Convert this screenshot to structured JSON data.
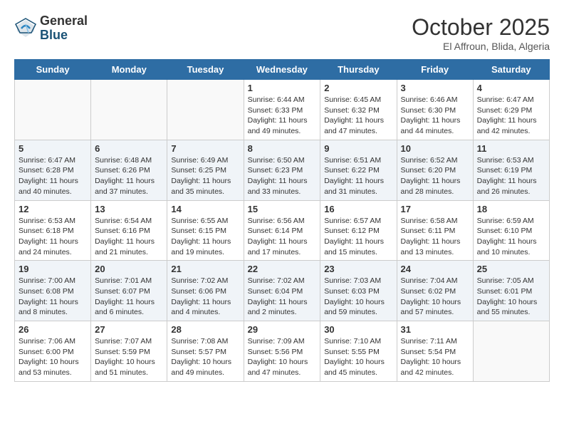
{
  "header": {
    "logo_general": "General",
    "logo_blue": "Blue",
    "month_title": "October 2025",
    "location": "El Affroun, Blida, Algeria"
  },
  "weekdays": [
    "Sunday",
    "Monday",
    "Tuesday",
    "Wednesday",
    "Thursday",
    "Friday",
    "Saturday"
  ],
  "weeks": [
    [
      {
        "day": "",
        "info": ""
      },
      {
        "day": "",
        "info": ""
      },
      {
        "day": "",
        "info": ""
      },
      {
        "day": "1",
        "info": "Sunrise: 6:44 AM\nSunset: 6:33 PM\nDaylight: 11 hours and 49 minutes."
      },
      {
        "day": "2",
        "info": "Sunrise: 6:45 AM\nSunset: 6:32 PM\nDaylight: 11 hours and 47 minutes."
      },
      {
        "day": "3",
        "info": "Sunrise: 6:46 AM\nSunset: 6:30 PM\nDaylight: 11 hours and 44 minutes."
      },
      {
        "day": "4",
        "info": "Sunrise: 6:47 AM\nSunset: 6:29 PM\nDaylight: 11 hours and 42 minutes."
      }
    ],
    [
      {
        "day": "5",
        "info": "Sunrise: 6:47 AM\nSunset: 6:28 PM\nDaylight: 11 hours and 40 minutes."
      },
      {
        "day": "6",
        "info": "Sunrise: 6:48 AM\nSunset: 6:26 PM\nDaylight: 11 hours and 37 minutes."
      },
      {
        "day": "7",
        "info": "Sunrise: 6:49 AM\nSunset: 6:25 PM\nDaylight: 11 hours and 35 minutes."
      },
      {
        "day": "8",
        "info": "Sunrise: 6:50 AM\nSunset: 6:23 PM\nDaylight: 11 hours and 33 minutes."
      },
      {
        "day": "9",
        "info": "Sunrise: 6:51 AM\nSunset: 6:22 PM\nDaylight: 11 hours and 31 minutes."
      },
      {
        "day": "10",
        "info": "Sunrise: 6:52 AM\nSunset: 6:20 PM\nDaylight: 11 hours and 28 minutes."
      },
      {
        "day": "11",
        "info": "Sunrise: 6:53 AM\nSunset: 6:19 PM\nDaylight: 11 hours and 26 minutes."
      }
    ],
    [
      {
        "day": "12",
        "info": "Sunrise: 6:53 AM\nSunset: 6:18 PM\nDaylight: 11 hours and 24 minutes."
      },
      {
        "day": "13",
        "info": "Sunrise: 6:54 AM\nSunset: 6:16 PM\nDaylight: 11 hours and 21 minutes."
      },
      {
        "day": "14",
        "info": "Sunrise: 6:55 AM\nSunset: 6:15 PM\nDaylight: 11 hours and 19 minutes."
      },
      {
        "day": "15",
        "info": "Sunrise: 6:56 AM\nSunset: 6:14 PM\nDaylight: 11 hours and 17 minutes."
      },
      {
        "day": "16",
        "info": "Sunrise: 6:57 AM\nSunset: 6:12 PM\nDaylight: 11 hours and 15 minutes."
      },
      {
        "day": "17",
        "info": "Sunrise: 6:58 AM\nSunset: 6:11 PM\nDaylight: 11 hours and 13 minutes."
      },
      {
        "day": "18",
        "info": "Sunrise: 6:59 AM\nSunset: 6:10 PM\nDaylight: 11 hours and 10 minutes."
      }
    ],
    [
      {
        "day": "19",
        "info": "Sunrise: 7:00 AM\nSunset: 6:08 PM\nDaylight: 11 hours and 8 minutes."
      },
      {
        "day": "20",
        "info": "Sunrise: 7:01 AM\nSunset: 6:07 PM\nDaylight: 11 hours and 6 minutes."
      },
      {
        "day": "21",
        "info": "Sunrise: 7:02 AM\nSunset: 6:06 PM\nDaylight: 11 hours and 4 minutes."
      },
      {
        "day": "22",
        "info": "Sunrise: 7:02 AM\nSunset: 6:04 PM\nDaylight: 11 hours and 2 minutes."
      },
      {
        "day": "23",
        "info": "Sunrise: 7:03 AM\nSunset: 6:03 PM\nDaylight: 10 hours and 59 minutes."
      },
      {
        "day": "24",
        "info": "Sunrise: 7:04 AM\nSunset: 6:02 PM\nDaylight: 10 hours and 57 minutes."
      },
      {
        "day": "25",
        "info": "Sunrise: 7:05 AM\nSunset: 6:01 PM\nDaylight: 10 hours and 55 minutes."
      }
    ],
    [
      {
        "day": "26",
        "info": "Sunrise: 7:06 AM\nSunset: 6:00 PM\nDaylight: 10 hours and 53 minutes."
      },
      {
        "day": "27",
        "info": "Sunrise: 7:07 AM\nSunset: 5:59 PM\nDaylight: 10 hours and 51 minutes."
      },
      {
        "day": "28",
        "info": "Sunrise: 7:08 AM\nSunset: 5:57 PM\nDaylight: 10 hours and 49 minutes."
      },
      {
        "day": "29",
        "info": "Sunrise: 7:09 AM\nSunset: 5:56 PM\nDaylight: 10 hours and 47 minutes."
      },
      {
        "day": "30",
        "info": "Sunrise: 7:10 AM\nSunset: 5:55 PM\nDaylight: 10 hours and 45 minutes."
      },
      {
        "day": "31",
        "info": "Sunrise: 7:11 AM\nSunset: 5:54 PM\nDaylight: 10 hours and 42 minutes."
      },
      {
        "day": "",
        "info": ""
      }
    ]
  ]
}
